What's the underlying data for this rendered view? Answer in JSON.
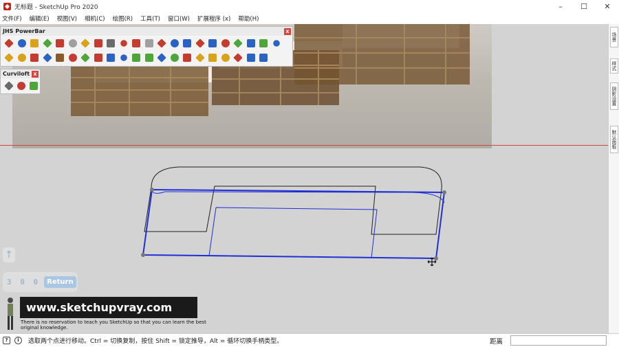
{
  "titlebar": {
    "title": "无标题 - SketchUp Pro 2020",
    "minimize": "–",
    "maximize": "☐",
    "close": "✕"
  },
  "menu": [
    "文件(F)",
    "编辑(E)",
    "视图(V)",
    "相机(C)",
    "绘图(R)",
    "工具(T)",
    "窗口(W)",
    "扩展程序 (x)",
    "帮助(H)"
  ],
  "toolbars": {
    "powerbar": {
      "title": "JHS PowerBar",
      "close": "x",
      "row1_icons": [
        "#c43b2f",
        "#2a63c4",
        "#d9a21b",
        "#4ea63a",
        "#c43b2f",
        "#a0a0a0",
        "#d9a21b",
        "#c43b2f",
        "#6a6a6a",
        "#c43b2f",
        "#c43b2f",
        "#a0a0a0",
        "#c43b2f",
        "#2a63c4",
        "#2a63c4",
        "#c43b2f",
        "#2a63c4",
        "#c43b2f",
        "#4ea63a",
        "#2a63c4",
        "#4ea63a",
        "#2a63c4"
      ],
      "row2_icons": [
        "#d9a21b",
        "#d9a21b",
        "#c43b2f",
        "#2a63c4",
        "#8a5a2b",
        "#c43b2f",
        "#4ea63a",
        "#c43b2f",
        "#2a63c4",
        "#2a63c4",
        "#4ea63a",
        "#4ea63a",
        "#2a63c4",
        "#4ea63a",
        "#c43b2f",
        "#d9a21b",
        "#d9a21b",
        "#d9a21b",
        "#c43b2f",
        "#2a63c4",
        "#2a63c4"
      ]
    },
    "curviloft": {
      "title": "Curviloft",
      "close": "x",
      "icons": [
        "#6a6a6a",
        "#c43b2f",
        "#4ea63a"
      ]
    }
  },
  "tray": {
    "tabs": [
      "场景",
      "样式",
      "阴影设置",
      "默认面板"
    ]
  },
  "viewport": {
    "vcb_value": "3 0 0",
    "return_label": "Return",
    "info_glyph": "↑",
    "brand": "www.sketchupvray.com",
    "tagline": "There is no reservation to teach you SketchUp so that you can learn the best original knowledge."
  },
  "status": {
    "text": "选取两个点进行移动。Ctrl = 切换复制，按住 Shift = 锁定推导，Alt = 循环切换手柄类型。",
    "measure_label": "距离",
    "measure_value": ""
  },
  "colors": {
    "edge_blue": "#1f2fd6",
    "edge_black": "#1e1e1e",
    "axis_red": "#c44444"
  }
}
